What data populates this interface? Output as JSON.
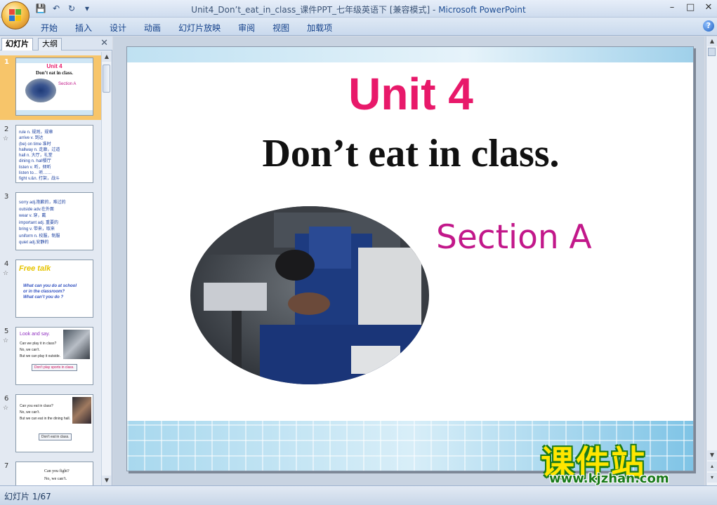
{
  "window": {
    "title_doc": "Unit4_Don’t_eat_in_class_课件PPT_七年级英语下 [兼容模式]",
    "title_sep": " - ",
    "title_app": "Microsoft PowerPoint"
  },
  "quick_access": [
    "save-icon",
    "undo-icon",
    "redo-icon",
    "customize-icon"
  ],
  "ribbon": {
    "tabs": [
      "开始",
      "插入",
      "设计",
      "动画",
      "幻灯片放映",
      "审阅",
      "视图",
      "加载项"
    ]
  },
  "panel": {
    "tab_slides": "幻灯片",
    "tab_outline": "大纲"
  },
  "thumbnails": [
    {
      "num": "1",
      "title": "Unit 4",
      "subtitle": "Don’t eat in class.",
      "section": "Section A"
    },
    {
      "num": "2",
      "lines": [
        "rule   n. 规则，规章",
        "arrive   v. 到达",
        "(be) on time   准时",
        "hallway   n. 走廊，过道",
        "hall   n. 大厅，礼堂",
        "dining   n. hall餐厅",
        "listen   v. 听，倾听",
        "listen to…   听……",
        "fight   v.&n. 打架，战斗"
      ]
    },
    {
      "num": "3",
      "lines": [
        "sorry   adj.抱歉的，难过的",
        "outside   adv.在外面",
        "wear   v. 穿，戴",
        "important   adj. 重要的",
        "bring   v. 带来，取来",
        "uniform   n. 校服，制服",
        "quiet   adj.安静的"
      ]
    },
    {
      "num": "4",
      "free": "Free talk",
      "lines": [
        "What can you do at school",
        "or in the classroom?",
        "What can’t you do ?"
      ]
    },
    {
      "num": "5",
      "head": "Look and say.",
      "lines": [
        "Can we play it in class?",
        "No, we can’t.",
        "But we can play it outside."
      ],
      "box": "Don’t play sports in class."
    },
    {
      "num": "6",
      "lines": [
        "Can you eat in class?",
        "No, we can’t.",
        "But we can eat in the dining hall."
      ],
      "box": "Don’t eat  in class."
    },
    {
      "num": "7",
      "lines": [
        "Can you fight?",
        "No, we can’t."
      ]
    }
  ],
  "slide": {
    "title": "Unit 4",
    "subtitle": "Don’t eat in class.",
    "section": "Section A"
  },
  "status": {
    "slide_counter": "幻灯片 1/67"
  },
  "watermark": {
    "cn": "课件站",
    "url": "www.kjzhan.com"
  },
  "colors": {
    "title_pink": "#e8196a",
    "section_magenta": "#c2188a",
    "selected_thumb": "#f7c56a"
  }
}
